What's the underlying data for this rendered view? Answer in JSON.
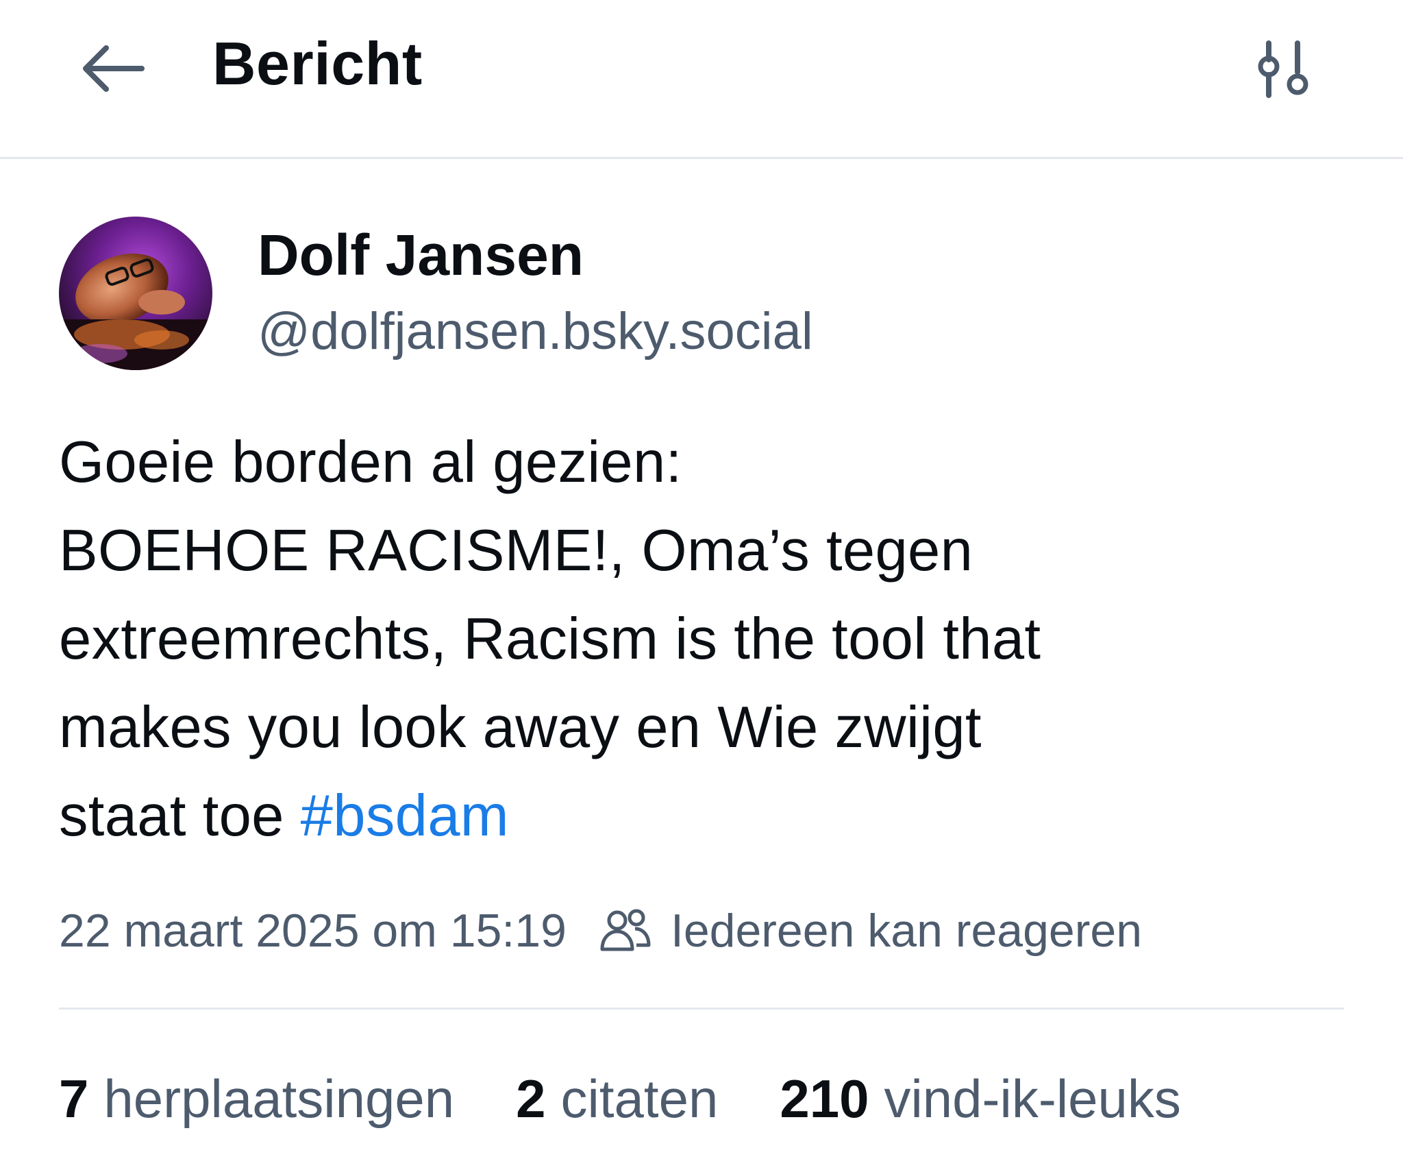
{
  "header": {
    "title": "Bericht",
    "back_icon": "arrow-left-icon",
    "settings_icon": "sliders-icon"
  },
  "author": {
    "display_name": "Dolf Jansen",
    "handle": "@dolfjansen.bsky.social"
  },
  "post": {
    "lines": [
      "Goeie borden al gezien:",
      "BOEHOE RACISME!, Oma’s tegen",
      "extreemrechts, Racism is the tool that",
      "makes you look away en Wie zwijgt"
    ],
    "last_line_text": "staat toe ",
    "hashtag": "#bsdam"
  },
  "meta": {
    "timestamp": "22 maart 2025 om 15:19",
    "reply_setting": "Iedereen kan reageren",
    "reply_icon": "people-icon"
  },
  "stats": {
    "reposts_count": "7",
    "reposts_label": "herplaatsingen",
    "quotes_count": "2",
    "quotes_label": "citaten",
    "likes_count": "210",
    "likes_label": "vind-ik-leuks"
  },
  "colors": {
    "text": "#0b0f14",
    "muted": "#4d5b6d",
    "link": "#1a7ce6",
    "divider": "#e4e8ee"
  }
}
